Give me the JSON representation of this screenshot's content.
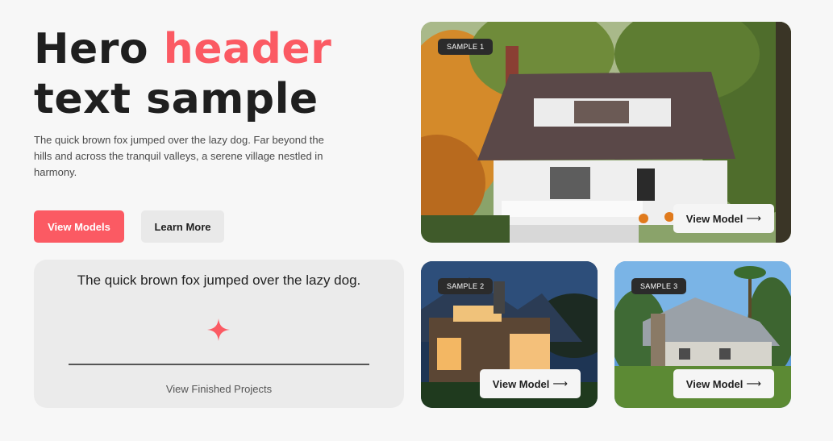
{
  "hero": {
    "title_line1": "Hero",
    "title_accent": "header",
    "title_line2": "text sample",
    "description": "The quick brown fox jumped over the lazy dog. Far beyond the hills and across the tranquil valleys, a serene village nestled in harmony."
  },
  "buttons": {
    "primary": "View Models",
    "secondary": "Learn More"
  },
  "quote_card": {
    "text": "The quick brown fox jumped over the lazy dog.",
    "icon": "sparkle-icon",
    "link": "View Finished Projects"
  },
  "samples": [
    {
      "badge": "SAMPLE 1",
      "button": "View Model",
      "arrow": "⟶"
    },
    {
      "badge": "SAMPLE 2",
      "button": "View Model",
      "arrow": "⟶"
    },
    {
      "badge": "SAMPLE 3",
      "button": "View Model",
      "arrow": "⟶"
    }
  ],
  "colors": {
    "accent": "#fb5a63",
    "text_dark": "#1f1f1f",
    "background": "#f7f7f7",
    "card_bg": "#ebebeb"
  }
}
